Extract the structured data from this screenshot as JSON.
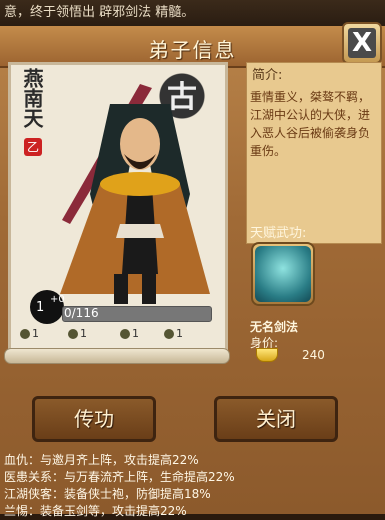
{
  "ticker": "意，终于领悟出 辟邪剑法 精髓。",
  "header": {
    "title": "弟子信息",
    "close_glyph": "X"
  },
  "portrait": {
    "name": "燕南天",
    "seal": "乙",
    "grade": "古",
    "level_value": "1",
    "level_plus": "+0",
    "exp": "0/116",
    "stats": [
      "1",
      "1",
      "1",
      "1"
    ]
  },
  "info": {
    "intro_label": "简介:",
    "intro_text": "重情重义，桀骜不羁，江湖中公认的大侠，进入恶人谷后被偷袭身负重伤。",
    "talent_label": "天赋武功:",
    "skill_name": "无名剑法",
    "worth_label": "身价:",
    "worth_value": "240"
  },
  "buttons": {
    "teach": "传功",
    "close": "关闭"
  },
  "fates": [
    "血仇：与邀月齐上阵，攻击提高22%",
    "医患关系：与万春流齐上阵，生命提高22%",
    "江湖侠客：装备侠士袍，防御提高18%",
    "兰惕：装备玉剑等，攻击提高22%"
  ],
  "colors": {
    "panel": "#a06a36",
    "title": "#c48c4b",
    "button": "#7a4c22"
  }
}
